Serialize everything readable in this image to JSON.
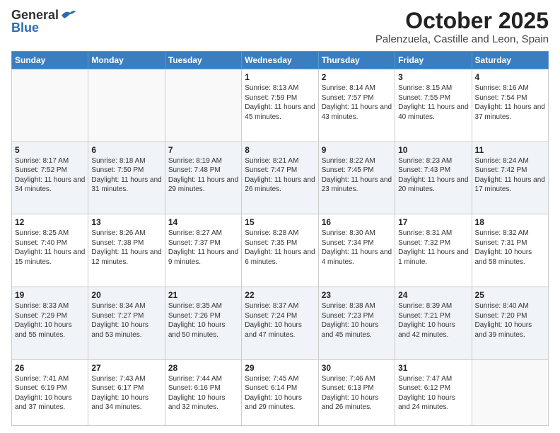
{
  "header": {
    "logo_general": "General",
    "logo_blue": "Blue",
    "month": "October 2025",
    "location": "Palenzuela, Castille and Leon, Spain"
  },
  "days_of_week": [
    "Sunday",
    "Monday",
    "Tuesday",
    "Wednesday",
    "Thursday",
    "Friday",
    "Saturday"
  ],
  "weeks": [
    [
      {
        "num": "",
        "text": ""
      },
      {
        "num": "",
        "text": ""
      },
      {
        "num": "",
        "text": ""
      },
      {
        "num": "1",
        "text": "Sunrise: 8:13 AM\nSunset: 7:59 PM\nDaylight: 11 hours and 45 minutes."
      },
      {
        "num": "2",
        "text": "Sunrise: 8:14 AM\nSunset: 7:57 PM\nDaylight: 11 hours and 43 minutes."
      },
      {
        "num": "3",
        "text": "Sunrise: 8:15 AM\nSunset: 7:55 PM\nDaylight: 11 hours and 40 minutes."
      },
      {
        "num": "4",
        "text": "Sunrise: 8:16 AM\nSunset: 7:54 PM\nDaylight: 11 hours and 37 minutes."
      }
    ],
    [
      {
        "num": "5",
        "text": "Sunrise: 8:17 AM\nSunset: 7:52 PM\nDaylight: 11 hours and 34 minutes."
      },
      {
        "num": "6",
        "text": "Sunrise: 8:18 AM\nSunset: 7:50 PM\nDaylight: 11 hours and 31 minutes."
      },
      {
        "num": "7",
        "text": "Sunrise: 8:19 AM\nSunset: 7:48 PM\nDaylight: 11 hours and 29 minutes."
      },
      {
        "num": "8",
        "text": "Sunrise: 8:21 AM\nSunset: 7:47 PM\nDaylight: 11 hours and 26 minutes."
      },
      {
        "num": "9",
        "text": "Sunrise: 8:22 AM\nSunset: 7:45 PM\nDaylight: 11 hours and 23 minutes."
      },
      {
        "num": "10",
        "text": "Sunrise: 8:23 AM\nSunset: 7:43 PM\nDaylight: 11 hours and 20 minutes."
      },
      {
        "num": "11",
        "text": "Sunrise: 8:24 AM\nSunset: 7:42 PM\nDaylight: 11 hours and 17 minutes."
      }
    ],
    [
      {
        "num": "12",
        "text": "Sunrise: 8:25 AM\nSunset: 7:40 PM\nDaylight: 11 hours and 15 minutes."
      },
      {
        "num": "13",
        "text": "Sunrise: 8:26 AM\nSunset: 7:38 PM\nDaylight: 11 hours and 12 minutes."
      },
      {
        "num": "14",
        "text": "Sunrise: 8:27 AM\nSunset: 7:37 PM\nDaylight: 11 hours and 9 minutes."
      },
      {
        "num": "15",
        "text": "Sunrise: 8:28 AM\nSunset: 7:35 PM\nDaylight: 11 hours and 6 minutes."
      },
      {
        "num": "16",
        "text": "Sunrise: 8:30 AM\nSunset: 7:34 PM\nDaylight: 11 hours and 4 minutes."
      },
      {
        "num": "17",
        "text": "Sunrise: 8:31 AM\nSunset: 7:32 PM\nDaylight: 11 hours and 1 minute."
      },
      {
        "num": "18",
        "text": "Sunrise: 8:32 AM\nSunset: 7:31 PM\nDaylight: 10 hours and 58 minutes."
      }
    ],
    [
      {
        "num": "19",
        "text": "Sunrise: 8:33 AM\nSunset: 7:29 PM\nDaylight: 10 hours and 55 minutes."
      },
      {
        "num": "20",
        "text": "Sunrise: 8:34 AM\nSunset: 7:27 PM\nDaylight: 10 hours and 53 minutes."
      },
      {
        "num": "21",
        "text": "Sunrise: 8:35 AM\nSunset: 7:26 PM\nDaylight: 10 hours and 50 minutes."
      },
      {
        "num": "22",
        "text": "Sunrise: 8:37 AM\nSunset: 7:24 PM\nDaylight: 10 hours and 47 minutes."
      },
      {
        "num": "23",
        "text": "Sunrise: 8:38 AM\nSunset: 7:23 PM\nDaylight: 10 hours and 45 minutes."
      },
      {
        "num": "24",
        "text": "Sunrise: 8:39 AM\nSunset: 7:21 PM\nDaylight: 10 hours and 42 minutes."
      },
      {
        "num": "25",
        "text": "Sunrise: 8:40 AM\nSunset: 7:20 PM\nDaylight: 10 hours and 39 minutes."
      }
    ],
    [
      {
        "num": "26",
        "text": "Sunrise: 7:41 AM\nSunset: 6:19 PM\nDaylight: 10 hours and 37 minutes."
      },
      {
        "num": "27",
        "text": "Sunrise: 7:43 AM\nSunset: 6:17 PM\nDaylight: 10 hours and 34 minutes."
      },
      {
        "num": "28",
        "text": "Sunrise: 7:44 AM\nSunset: 6:16 PM\nDaylight: 10 hours and 32 minutes."
      },
      {
        "num": "29",
        "text": "Sunrise: 7:45 AM\nSunset: 6:14 PM\nDaylight: 10 hours and 29 minutes."
      },
      {
        "num": "30",
        "text": "Sunrise: 7:46 AM\nSunset: 6:13 PM\nDaylight: 10 hours and 26 minutes."
      },
      {
        "num": "31",
        "text": "Sunrise: 7:47 AM\nSunset: 6:12 PM\nDaylight: 10 hours and 24 minutes."
      },
      {
        "num": "",
        "text": ""
      }
    ]
  ]
}
